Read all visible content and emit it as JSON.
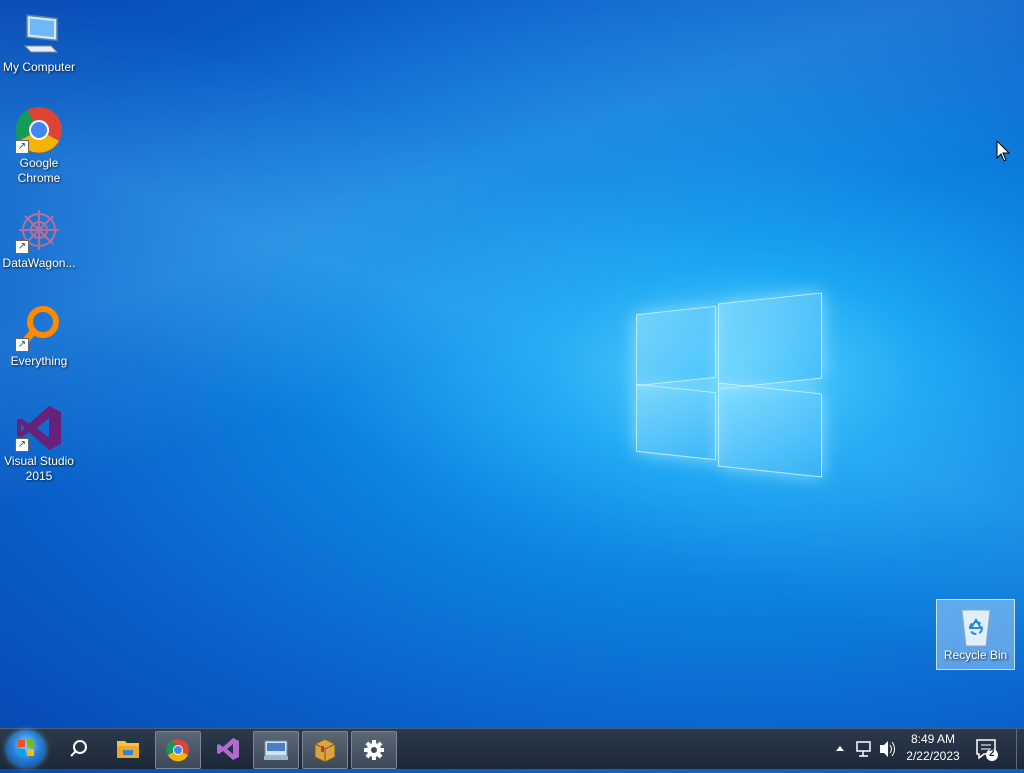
{
  "desktop": {
    "icons": [
      {
        "label": "My Computer",
        "icon": "computer-icon"
      },
      {
        "label": "Google\nChrome",
        "icon": "chrome-icon"
      },
      {
        "label": "DataWagon...",
        "icon": "datawagon-icon"
      },
      {
        "label": "Everything",
        "icon": "everything-icon"
      },
      {
        "label": "Visual Studio\n2015",
        "icon": "visual-studio-icon"
      }
    ],
    "recycle_bin": {
      "label": "Recycle Bin",
      "icon": "recycle-bin-icon"
    }
  },
  "taskbar": {
    "items": [
      "start-orb",
      "search-icon",
      "file-explorer-icon",
      "chrome-icon",
      "visual-studio-icon",
      "keyboard-tool-icon",
      "package-icon",
      "settings-gear-icon"
    ],
    "clock": {
      "time": "8:49 AM",
      "date": "2/22/2023"
    },
    "notifications": {
      "count": "2"
    }
  },
  "colors": {
    "taskbar": "#1c2838",
    "desktop": "#0a6fd6"
  }
}
